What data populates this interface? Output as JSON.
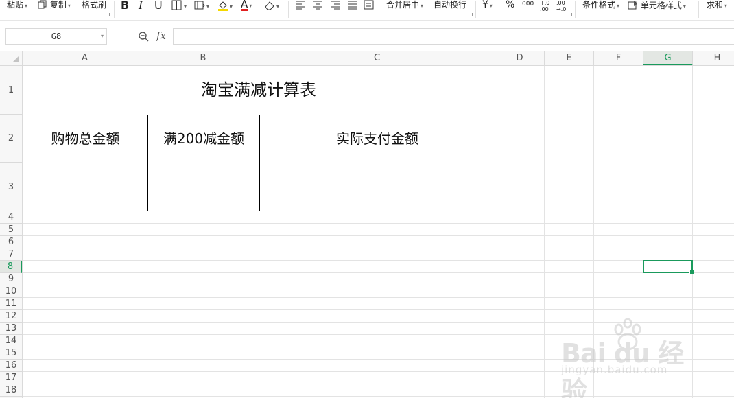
{
  "toolbar": {
    "paste_label": "粘贴",
    "copy_label": "复制",
    "format_painter_label": "格式刷",
    "bold_label": "B",
    "italic_label": "I",
    "underline_label": "U",
    "merge_center_label": "合并居中",
    "wrap_text_label": "自动换行",
    "currency_label": "¥",
    "percent_label": "%",
    "thousands_label": "000",
    "inc_decimal_label": "+.0 .00",
    "dec_decimal_label": ".00 →.0",
    "conditional_format_label": "条件格式",
    "cell_style_label": "单元格样式",
    "sum_label": "求和",
    "font_color": "#e02020",
    "fill_color": "#f5d800"
  },
  "formula_bar": {
    "name_box_value": "G8",
    "fx_label": "fx",
    "formula_value": ""
  },
  "columns": [
    "A",
    "B",
    "C",
    "D",
    "E",
    "F",
    "G",
    "H"
  ],
  "rows": [
    "1",
    "2",
    "3",
    "4",
    "5",
    "6",
    "7",
    "8",
    "9",
    "10",
    "11",
    "12",
    "13",
    "14",
    "15",
    "16",
    "17",
    "18"
  ],
  "active_cell": {
    "column": "G",
    "row": "8"
  },
  "sheet": {
    "title": "淘宝满减计算表",
    "headers": [
      "购物总金额",
      "满200减金额",
      "实际支付金额"
    ],
    "row3": [
      "",
      "",
      ""
    ]
  },
  "watermark": {
    "brand": "Bai du 经验",
    "url": "jingyan.baidu.com"
  },
  "colors": {
    "accent": "#1a9a5c",
    "grid": "#e3e3e3",
    "header_bg": "#f7f7f7"
  }
}
